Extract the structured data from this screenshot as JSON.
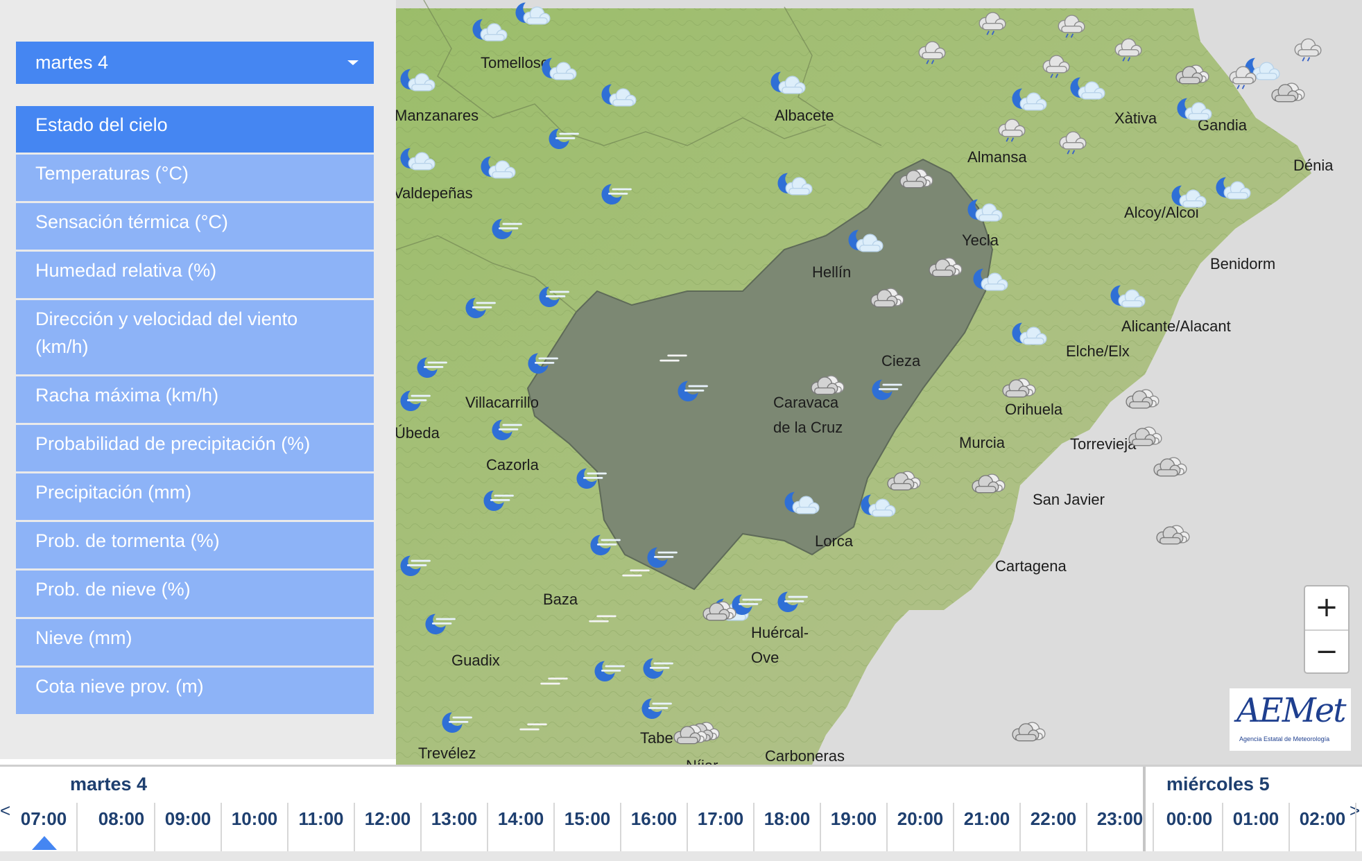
{
  "sidebar": {
    "day_select": "martes 4",
    "menu": [
      {
        "label": "Estado del cielo"
      },
      {
        "label": "Temperaturas (°C)"
      },
      {
        "label": "Sensación térmica (°C)"
      },
      {
        "label": "Humedad relativa (%)"
      },
      {
        "label": "Dirección y velocidad del viento (km/h)"
      },
      {
        "label": "Racha máxima (km/h)"
      },
      {
        "label": "Probabilidad de precipitación (%)"
      },
      {
        "label": "Precipitación (mm)"
      },
      {
        "label": "Prob. de tormenta (%)"
      },
      {
        "label": "Prob. de nieve (%)"
      },
      {
        "label": "Nieve (mm)"
      },
      {
        "label": "Cota nieve prov. (m)"
      }
    ]
  },
  "map": {
    "cities": [
      {
        "name": "Tomelloso"
      },
      {
        "name": "Manzanares"
      },
      {
        "name": "Valdepeñas"
      },
      {
        "name": "Albacete"
      },
      {
        "name": "Almansa"
      },
      {
        "name": "Xàtiva"
      },
      {
        "name": "Gandia"
      },
      {
        "name": "Dénia"
      },
      {
        "name": "Alcoy/Alcoi"
      },
      {
        "name": "Benidorm"
      },
      {
        "name": "Yecla"
      },
      {
        "name": "Hellín"
      },
      {
        "name": "Alicante/Alacant"
      },
      {
        "name": "Elche/Elx"
      },
      {
        "name": "Cieza"
      },
      {
        "name": "Caravaca"
      },
      {
        "name": "de la Cruz"
      },
      {
        "name": "Orihuela"
      },
      {
        "name": "Murcia"
      },
      {
        "name": "Torrevieja"
      },
      {
        "name": "San Javier"
      },
      {
        "name": "Lorca"
      },
      {
        "name": "Cartagena"
      },
      {
        "name": "Villacarrillo"
      },
      {
        "name": "Úbeda"
      },
      {
        "name": "Cazorla"
      },
      {
        "name": "Baza"
      },
      {
        "name": "Guadix"
      },
      {
        "name": "Huércal-"
      },
      {
        "name": "Ove"
      },
      {
        "name": "Trevélez"
      },
      {
        "name": "Tabe"
      },
      {
        "name": "Níjar"
      },
      {
        "name": "Carboneras"
      }
    ],
    "weather_icons": [
      {
        "type": "moon-cloud"
      },
      {
        "type": "moon-cloud"
      },
      {
        "type": "moon-cloud"
      },
      {
        "type": "moon-cloud"
      },
      {
        "type": "moon-cloud"
      },
      {
        "type": "moon-cloud"
      },
      {
        "type": "moon-cloud"
      },
      {
        "type": "moon-cloud"
      },
      {
        "type": "moon-cloud"
      },
      {
        "type": "moon-cloud"
      },
      {
        "type": "moon-cloud"
      },
      {
        "type": "moon-cloud"
      },
      {
        "type": "moon-cloud"
      },
      {
        "type": "moon-cloud"
      },
      {
        "type": "moon-cloud"
      },
      {
        "type": "moon-cloud"
      },
      {
        "type": "moon-cloud"
      },
      {
        "type": "moon-cloud"
      },
      {
        "type": "moon-cloud"
      },
      {
        "type": "moon-cloud"
      },
      {
        "type": "moon-cloud"
      },
      {
        "type": "moon-cloud"
      },
      {
        "type": "moon-cloud"
      },
      {
        "type": "moon-haze"
      },
      {
        "type": "moon-haze"
      },
      {
        "type": "moon-haze"
      },
      {
        "type": "moon-haze"
      },
      {
        "type": "moon-haze"
      },
      {
        "type": "moon-haze"
      },
      {
        "type": "moon-haze"
      },
      {
        "type": "moon-haze"
      },
      {
        "type": "moon-haze"
      },
      {
        "type": "moon-haze"
      },
      {
        "type": "moon-haze"
      },
      {
        "type": "moon-haze"
      },
      {
        "type": "moon-haze"
      },
      {
        "type": "moon-haze"
      },
      {
        "type": "moon-haze"
      },
      {
        "type": "moon-haze"
      },
      {
        "type": "moon-haze"
      },
      {
        "type": "moon-haze"
      },
      {
        "type": "moon-haze"
      },
      {
        "type": "moon-haze"
      },
      {
        "type": "moon-haze"
      },
      {
        "type": "moon-haze"
      },
      {
        "type": "moon-haze"
      },
      {
        "type": "overcast"
      },
      {
        "type": "overcast"
      },
      {
        "type": "overcast"
      },
      {
        "type": "overcast"
      },
      {
        "type": "overcast"
      },
      {
        "type": "overcast"
      },
      {
        "type": "overcast"
      },
      {
        "type": "overcast"
      },
      {
        "type": "overcast"
      },
      {
        "type": "overcast"
      },
      {
        "type": "overcast"
      },
      {
        "type": "overcast"
      },
      {
        "type": "overcast"
      },
      {
        "type": "overcast"
      },
      {
        "type": "overcast"
      },
      {
        "type": "overcast"
      },
      {
        "type": "overcast"
      },
      {
        "type": "light-rain"
      },
      {
        "type": "light-rain"
      },
      {
        "type": "light-rain"
      },
      {
        "type": "light-rain"
      },
      {
        "type": "light-rain"
      },
      {
        "type": "light-rain"
      },
      {
        "type": "light-rain"
      },
      {
        "type": "light-rain"
      },
      {
        "type": "light-rain"
      },
      {
        "type": "fog"
      },
      {
        "type": "fog"
      },
      {
        "type": "fog"
      },
      {
        "type": "fog"
      },
      {
        "type": "fog"
      }
    ],
    "zoom_in": "+",
    "zoom_out": "−",
    "logo_text": "AEMet",
    "logo_sub": "Agencia Estatal de Meteorología"
  },
  "timeline": {
    "day1": "martes 4",
    "day2": "miércoles 5",
    "hours": [
      "07:00",
      "08:00",
      "09:00",
      "10:00",
      "11:00",
      "12:00",
      "13:00",
      "14:00",
      "15:00",
      "16:00",
      "17:00",
      "18:00",
      "19:00",
      "20:00",
      "21:00",
      "22:00",
      "23:00",
      "00:00",
      "01:00",
      "02:00"
    ],
    "prev": "<",
    "next": ">",
    "selected_hour": "07:00"
  },
  "colors": {
    "accent": "#4586f2",
    "menu_inactive": "#8db3f7",
    "region_fill": "#7c8873",
    "terrain": "#a3bd7b",
    "sea": "#dcdcdc",
    "timeline_text": "#1e3f6f"
  }
}
